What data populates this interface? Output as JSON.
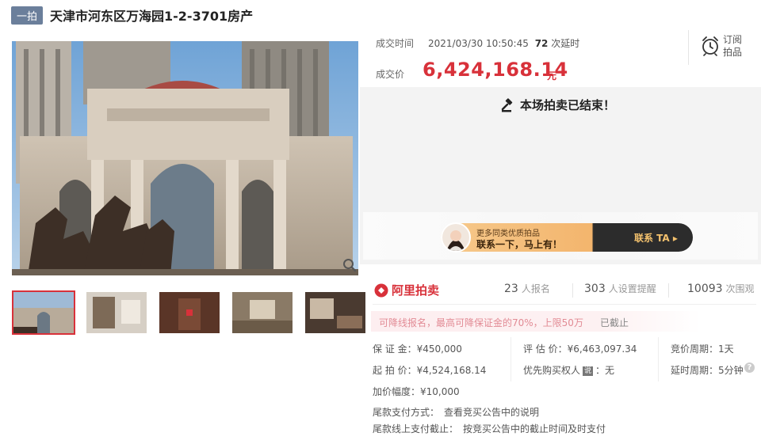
{
  "title": {
    "tag": "一拍",
    "text": "天津市河东区万海园1-2-3701房产"
  },
  "deal": {
    "time_label": "成交时间",
    "time": "2021/03/30 10:50:45",
    "delay_count": "72",
    "delay_label": "次延时",
    "price_label": "成交价",
    "price": "6,424,168.14",
    "unit": "元"
  },
  "subscribe": {
    "label": "订阅拍品"
  },
  "status": {
    "ended": "本场拍卖已结束！"
  },
  "promo": {
    "sub": "更多同类优质拍品",
    "main": "联系一下，马上有！",
    "button": "联系 TA ▸"
  },
  "brand": {
    "name": "阿里拍卖"
  },
  "stats": [
    {
      "num": "23",
      "label": "人报名"
    },
    {
      "num": "303",
      "label": "人设置提醒"
    },
    {
      "num": "10093",
      "label": "次围观"
    }
  ],
  "notice": {
    "text": "可降线报名，最高可降保证金的70%，上限50万",
    "status": "已截止"
  },
  "info": {
    "deposit_label": "保 证 金：",
    "deposit": "¥450,000",
    "appraise_label": "评 估 价：",
    "appraise": "¥6,463,097.34",
    "period_label": "竞价周期：",
    "period": "1天",
    "start_label": "起 拍 价：",
    "start": "¥4,524,168.14",
    "priority_label": "优先购买权人",
    "priority_badge": "说",
    "priority": "：无",
    "delay_label": "延时周期：",
    "delay": "5分钟",
    "increment_label": "加价幅度：",
    "increment": "¥10,000",
    "payment_label": "尾款支付方式：",
    "payment": "查看竞买公告中的说明",
    "deadline_label": "尾款线上支付截止：",
    "deadline": "按竞买公告中的截止时间及时支付"
  },
  "colors": {
    "accent": "#d8313a",
    "tag": "#6b7f9b"
  },
  "icons": {
    "zoom": "magnifier-icon",
    "subscribe": "alarm-clock-icon",
    "ended": "gavel-icon",
    "help": "question-icon"
  }
}
